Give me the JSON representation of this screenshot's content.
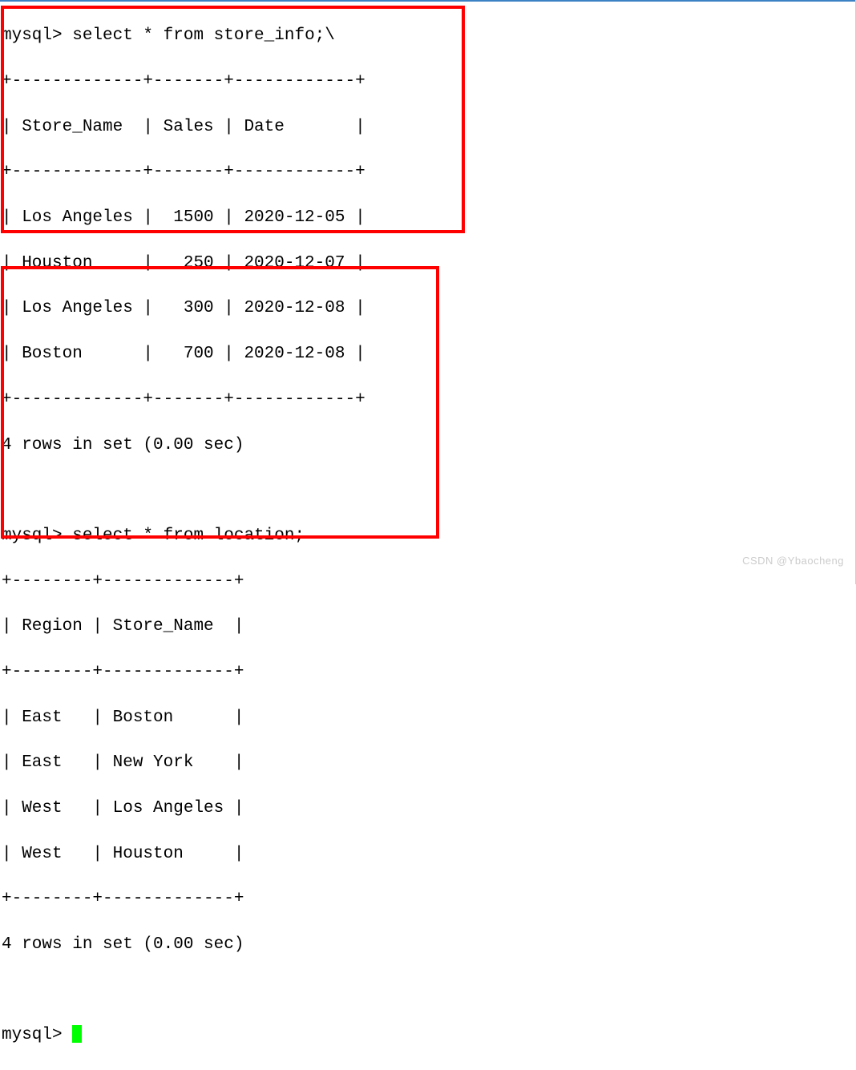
{
  "terminal": {
    "prompt": "mysql> ",
    "query1": {
      "command": "select * from store_info;\\",
      "separator_top": "+-------------+-------+------------+",
      "header": "| Store_Name  | Sales | Date       |",
      "separator_mid": "+-------------+-------+------------+",
      "rows": [
        "| Los Angeles |  1500 | 2020-12-05 |",
        "| Houston     |   250 | 2020-12-07 |",
        "| Los Angeles |   300 | 2020-12-08 |",
        "| Boston      |   700 | 2020-12-08 |"
      ],
      "separator_bottom": "+-------------+-------+------------+",
      "result": "4 rows in set (0.00 sec)"
    },
    "query2": {
      "command": "select * from location;",
      "separator_top": "+--------+-------------+",
      "header": "| Region | Store_Name  |",
      "separator_mid": "+--------+-------------+",
      "rows": [
        "| East   | Boston      |",
        "| East   | New York    |",
        "| West   | Los Angeles |",
        "| West   | Houston     |"
      ],
      "separator_bottom": "+--------+-------------+",
      "result": "4 rows in set (0.00 sec)"
    }
  },
  "watermark": "CSDN @Ybaocheng",
  "data": {
    "store_info": [
      {
        "Store_Name": "Los Angeles",
        "Sales": 1500,
        "Date": "2020-12-05"
      },
      {
        "Store_Name": "Houston",
        "Sales": 250,
        "Date": "2020-12-07"
      },
      {
        "Store_Name": "Los Angeles",
        "Sales": 300,
        "Date": "2020-12-08"
      },
      {
        "Store_Name": "Boston",
        "Sales": 700,
        "Date": "2020-12-08"
      }
    ],
    "location": [
      {
        "Region": "East",
        "Store_Name": "Boston"
      },
      {
        "Region": "East",
        "Store_Name": "New York"
      },
      {
        "Region": "West",
        "Store_Name": "Los Angeles"
      },
      {
        "Region": "West",
        "Store_Name": "Houston"
      }
    ]
  }
}
